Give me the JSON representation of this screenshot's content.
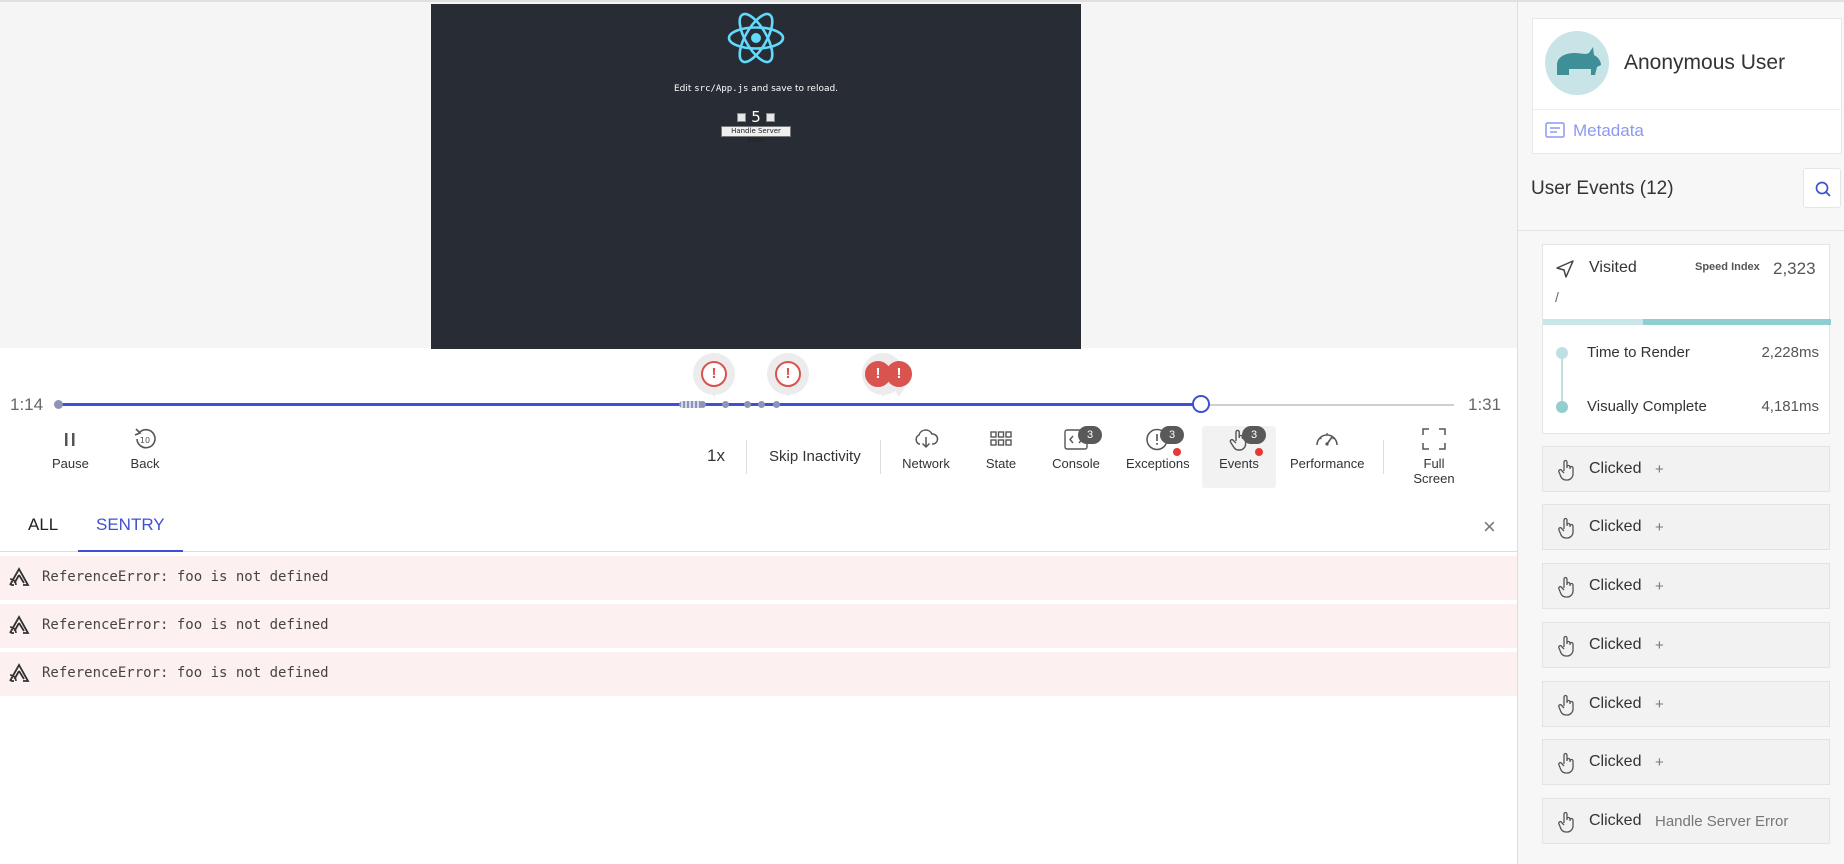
{
  "screen": {
    "edit_prefix": "Edit ",
    "edit_code": "src/App.js",
    "edit_suffix": " and save to reload.",
    "counter_value": "5",
    "server_button": "Handle Server Error"
  },
  "timeline": {
    "current_time": "1:14",
    "total_time": "1:31",
    "progress": 0.8188
  },
  "controls": {
    "pause": "Pause",
    "back": "Back",
    "back_seconds": "10",
    "speed": "1x",
    "skip": "Skip Inactivity",
    "network": "Network",
    "state": "State",
    "console": "Console",
    "console_count": "3",
    "exceptions": "Exceptions",
    "exceptions_count": "3",
    "events": "Events",
    "events_count": "3",
    "performance": "Performance",
    "fullscreen": "Full Screen"
  },
  "tabs": {
    "all": "ALL",
    "sentry": "SENTRY",
    "close": "×"
  },
  "errors": [
    "ReferenceError: foo is not defined",
    "ReferenceError: foo is not defined",
    "ReferenceError: foo is not defined"
  ],
  "sidebar": {
    "user_name": "Anonymous User",
    "metadata": "Metadata",
    "events_title": "User Events (12)",
    "visited": {
      "label": "Visited",
      "speed_index_label": "Speed Index",
      "speed_index_value": "2,323",
      "path": "/",
      "time_to_render_label": "Time to Render",
      "time_to_render_value": "2,228ms",
      "visually_complete_label": "Visually Complete",
      "visually_complete_value": "4,181ms"
    },
    "clicks": [
      {
        "label": "Clicked",
        "extra": "+"
      },
      {
        "label": "Clicked",
        "extra": "+"
      },
      {
        "label": "Clicked",
        "extra": "+"
      },
      {
        "label": "Clicked",
        "extra": "+"
      },
      {
        "label": "Clicked",
        "extra": "+"
      },
      {
        "label": "Clicked",
        "extra": "+"
      },
      {
        "label": "Clicked",
        "extra": "Handle Server Error"
      }
    ]
  },
  "colors": {
    "accent": "#3f51d3",
    "error": "#d9534f",
    "error_row_bg": "#fdf0f0",
    "metadata_link": "#8c99f0",
    "perf_bar": "#8ecdd0"
  }
}
